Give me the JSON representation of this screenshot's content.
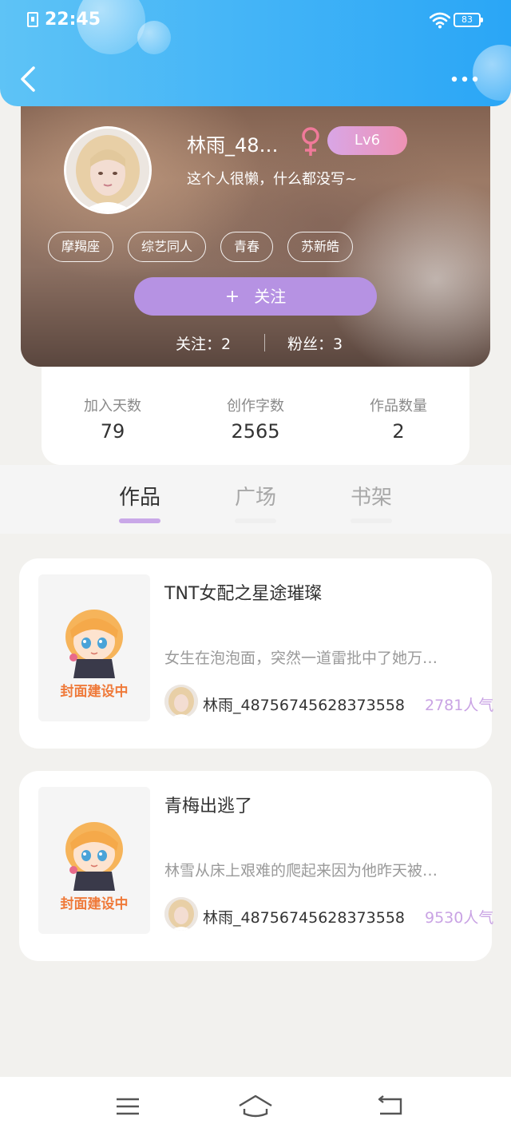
{
  "status_bar": {
    "time": "22:45",
    "battery": "83"
  },
  "header": {
    "back_icon": "chevron-left-icon",
    "more_icon": "more-dots-icon"
  },
  "profile": {
    "nickname": "林雨_48…",
    "gender_icon": "female-icon",
    "level": "Lv6",
    "bio": "这个人很懒，什么都没写~",
    "tags": [
      "摩羯座",
      "综艺同人",
      "青春",
      "苏新皓"
    ],
    "follow_button": {
      "icon": "+",
      "label": "关注"
    },
    "following": "关注：2",
    "fans": "粉丝：3"
  },
  "stats": [
    {
      "label": "加入天数",
      "value": "79"
    },
    {
      "label": "创作字数",
      "value": "2565"
    },
    {
      "label": "作品数量",
      "value": "2"
    }
  ],
  "tabs": [
    {
      "label": "作品",
      "active": true
    },
    {
      "label": "广场",
      "active": false
    },
    {
      "label": "书架",
      "active": false
    }
  ],
  "works": [
    {
      "title": "TNT女配之星途璀璨",
      "cover_text": "封面建设中",
      "description": "女生在泡泡面，突然一道雷批中了她万…",
      "author": "林雨_48756745628373558",
      "popularity": "2781人气"
    },
    {
      "title": "青梅出逃了",
      "cover_text": "封面建设中",
      "description": "林雪从床上艰难的爬起来因为他昨天被…",
      "author": "林雨_48756745628373558",
      "popularity": "9530人气"
    }
  ],
  "colors": {
    "header_blue": "#43b4f7",
    "accent_purple": "#b692e3",
    "level_badge": "#ee92b4",
    "popularity": "#c9a3e4",
    "cover_text": "#ef7a3a"
  },
  "nav_bar": {
    "icons": [
      "menu-icon",
      "home-icon",
      "back-nav-icon"
    ]
  }
}
